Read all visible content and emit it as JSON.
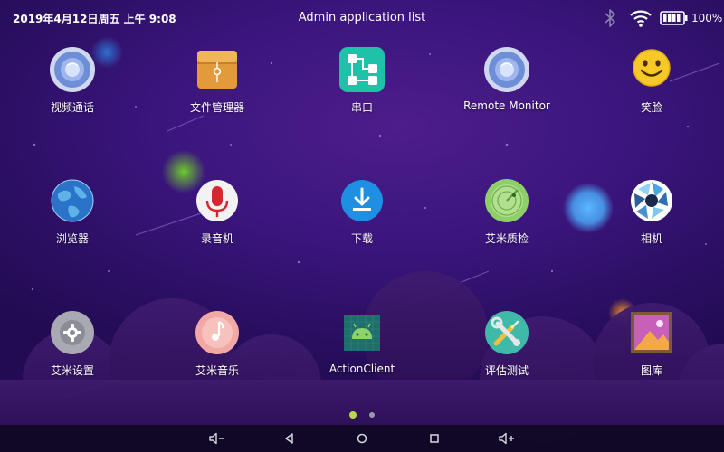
{
  "status_bar": {
    "datetime": "2019年4月12日周五  上午 9:08",
    "title": "Admin application list",
    "battery_percent": "100%"
  },
  "apps": [
    {
      "label": "视频通话",
      "icon": "video-call-icon"
    },
    {
      "label": "文件管理器",
      "icon": "file-manager-icon"
    },
    {
      "label": "串口",
      "icon": "serial-port-icon"
    },
    {
      "label": "Remote Monitor",
      "icon": "remote-monitor-icon"
    },
    {
      "label": "笑脸",
      "icon": "smiley-face-icon"
    },
    {
      "label": "浏览器",
      "icon": "browser-globe-icon"
    },
    {
      "label": "录音机",
      "icon": "recorder-microphone-icon"
    },
    {
      "label": "下载",
      "icon": "download-icon"
    },
    {
      "label": "艾米质检",
      "icon": "quality-check-radar-icon"
    },
    {
      "label": "相机",
      "icon": "camera-aperture-icon"
    },
    {
      "label": "艾米设置",
      "icon": "settings-gear-icon"
    },
    {
      "label": "艾米音乐",
      "icon": "music-note-icon"
    },
    {
      "label": "ActionClient",
      "icon": "android-robot-icon"
    },
    {
      "label": "评估测试",
      "icon": "tools-wrench-screwdriver-icon"
    },
    {
      "label": "图库",
      "icon": "gallery-picture-icon"
    }
  ],
  "pagination": {
    "current_page": 1,
    "total_pages": 2
  },
  "colors": {
    "background": "#3a157c",
    "active_dot": "#b9d84a",
    "inactive_dot": "#9a9aa8"
  }
}
